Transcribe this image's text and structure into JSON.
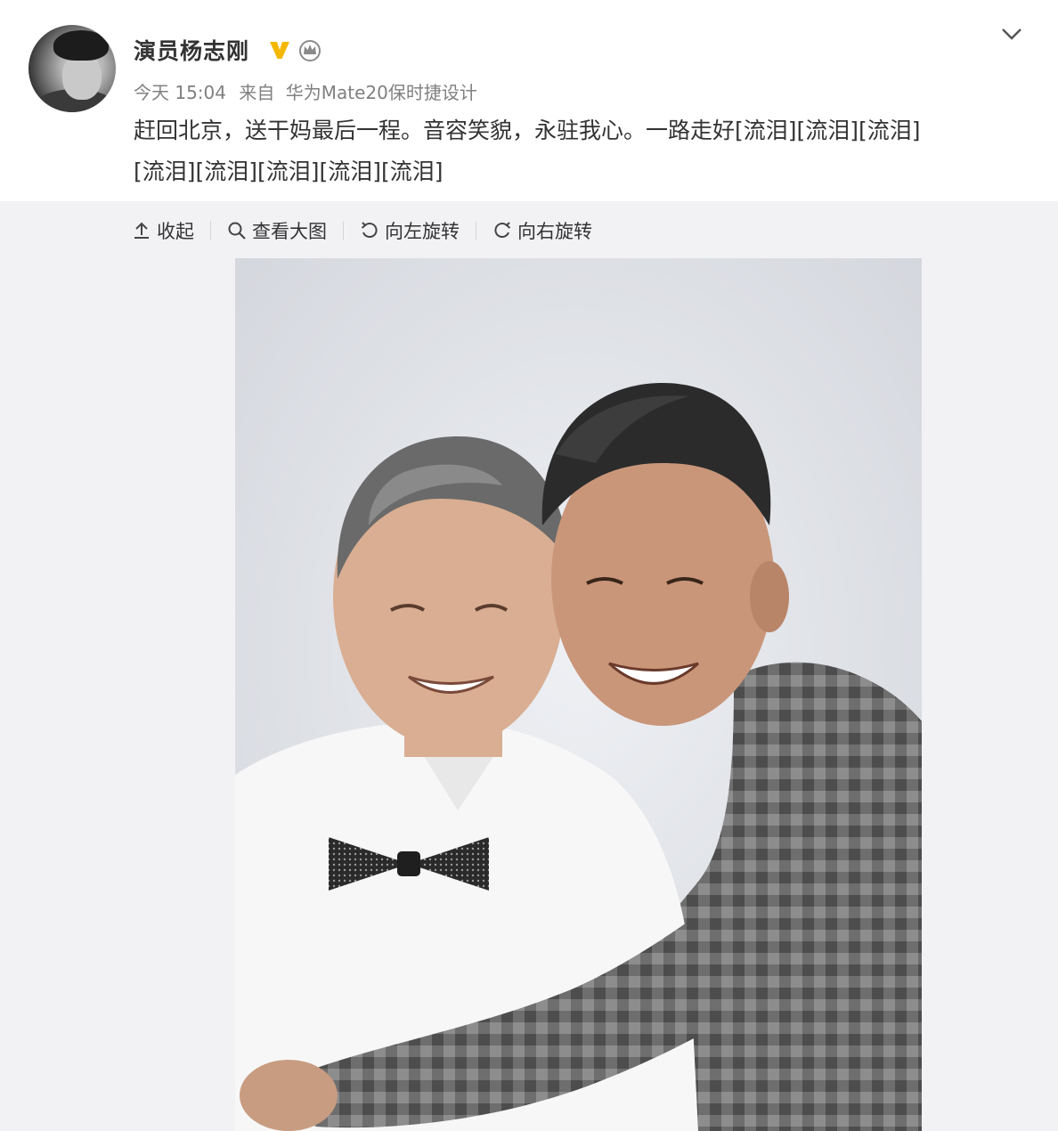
{
  "post": {
    "author": "演员杨志刚",
    "time": "今天 15:04",
    "source_prefix": "来自",
    "source": "华为Mate20保时捷设计",
    "text_line1": "赶回北京，送干妈最后一程。音容笑貌，永驻我心。一路走好[流泪][流泪][流泪]",
    "text_line2": "[流泪][流泪][流泪][流泪][流泪]"
  },
  "toolbar": {
    "collapse": "收起",
    "view_large": "查看大图",
    "rotate_left": "向左旋转",
    "rotate_right": "向右旋转"
  },
  "icons": {
    "verified": "verified-v-icon",
    "member": "crown-icon",
    "more": "chevron-down-icon",
    "collapse": "up-arrow-icon",
    "view_large": "magnifier-icon",
    "rotate_left": "rotate-left-icon",
    "rotate_right": "rotate-right-icon"
  },
  "colors": {
    "text": "#333333",
    "meta": "#808080",
    "verified_gold": "#f5b800",
    "media_bg": "#f2f2f5"
  }
}
